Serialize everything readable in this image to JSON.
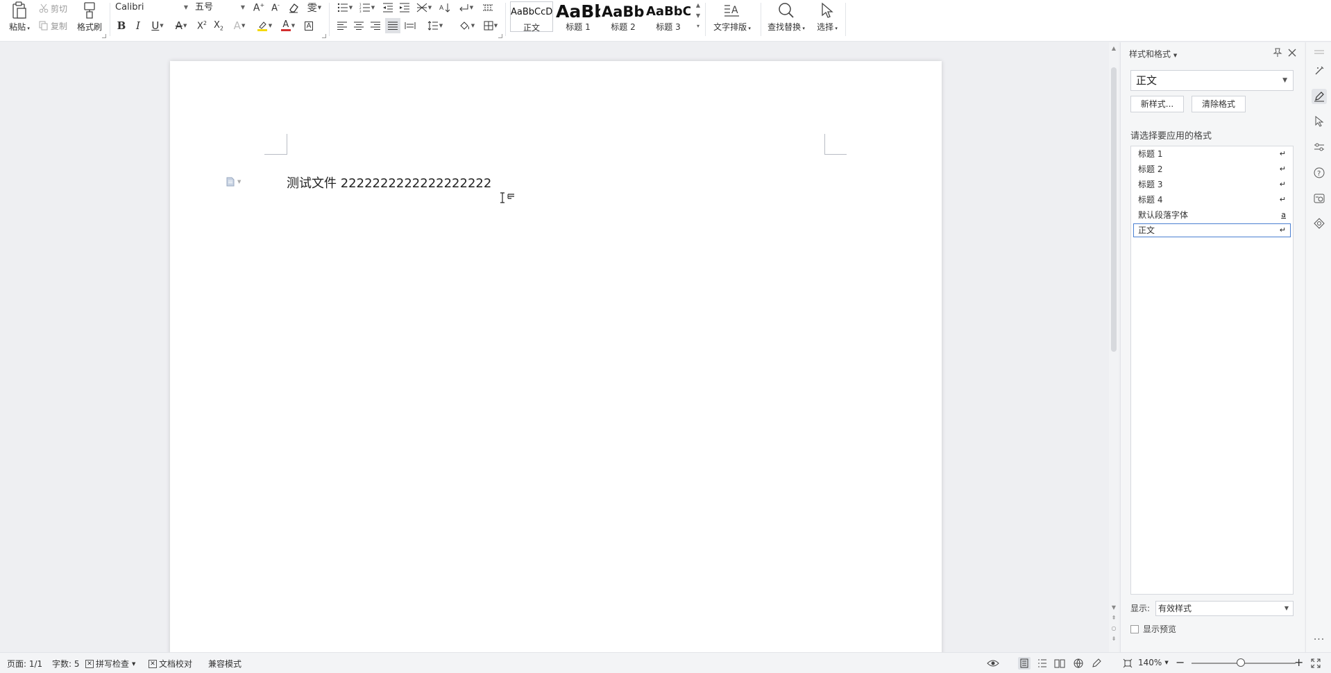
{
  "ribbon": {
    "clipboard": {
      "paste": "粘贴",
      "cut": "剪切",
      "copy": "复制",
      "format_painter": "格式刷"
    },
    "font": {
      "name": "Calibri",
      "size": "五号"
    },
    "styles": [
      {
        "preview": "AaBbCcDd",
        "name": "正文"
      },
      {
        "preview": "AaBb",
        "name": "标题 1"
      },
      {
        "preview": "AaBb(",
        "name": "标题 2"
      },
      {
        "preview": "AaBbC(",
        "name": "标题 3"
      }
    ],
    "text_layout": "文字排版",
    "find_replace": "查找替换",
    "select": "选择"
  },
  "document": {
    "text": "测试文件 2222222222222222222"
  },
  "style_pane": {
    "title": "样式和格式",
    "current_style": "正文",
    "new_style": "新样式...",
    "clear_format": "清除格式",
    "apply_hint": "请选择要应用的格式",
    "items": [
      {
        "label": "标题 1",
        "mark": "↵"
      },
      {
        "label": "标题 2",
        "mark": "↵"
      },
      {
        "label": "标题 3",
        "mark": "↵"
      },
      {
        "label": "标题 4",
        "mark": "↵"
      },
      {
        "label": "默认段落字体",
        "mark": "a"
      },
      {
        "label": "正文",
        "mark": "↵"
      }
    ],
    "selected_index": 5,
    "show_label": "显示:",
    "show_value": "有效样式",
    "preview_label": "显示预览"
  },
  "status": {
    "page": "页面: 1/1",
    "word_count": "字数: 5",
    "spell_check": "拼写检查",
    "doc_proof": "文档校对",
    "compat_mode": "兼容模式",
    "zoom": "140%",
    "zoom_fraction": 0.47
  },
  "colors": {
    "accent": "#4a7fd1",
    "highlight": "#f5d90a",
    "font_color": "#d32f2f",
    "pane_bg": "#f5f6f7",
    "canvas_bg": "#eeeff2"
  }
}
